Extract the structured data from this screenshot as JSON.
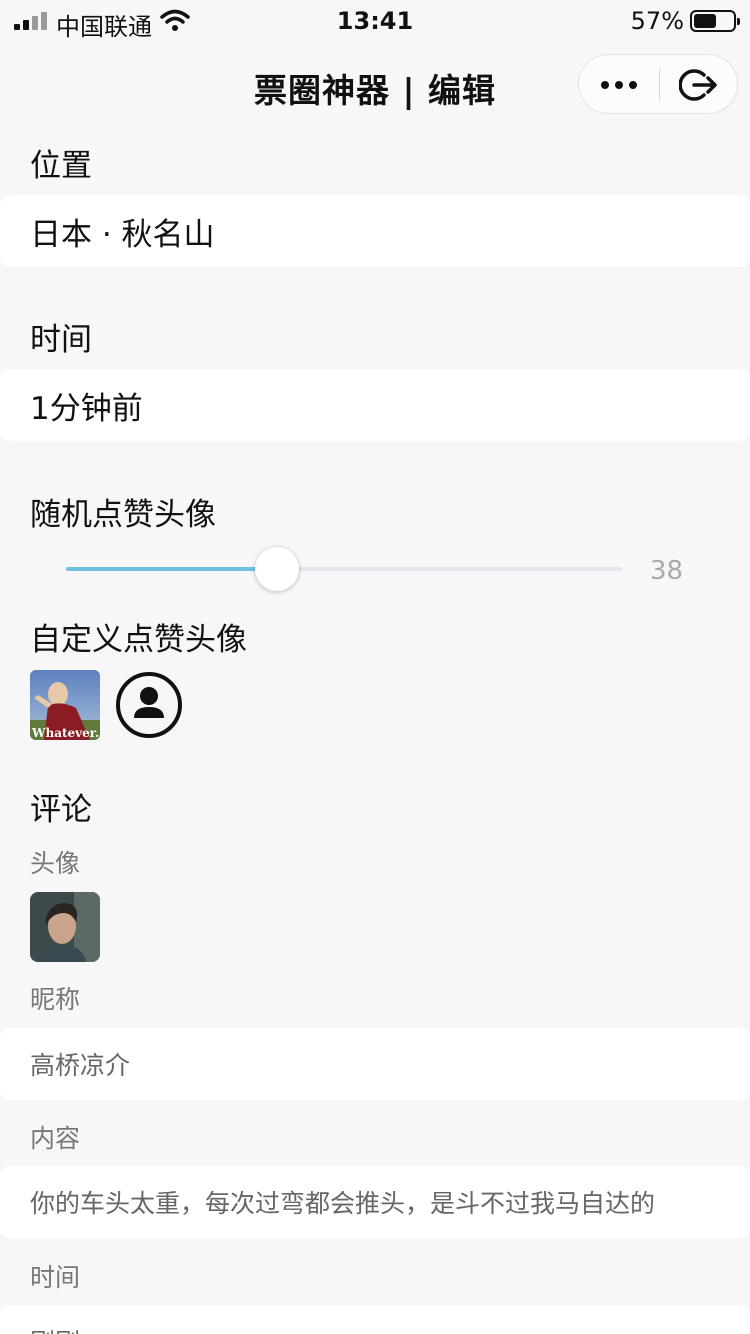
{
  "status_bar": {
    "carrier": "中国联通",
    "time": "13:41",
    "battery_percent": "57%",
    "battery_level": 0.57
  },
  "nav": {
    "title": "票圈神器 | 编辑",
    "more_icon": "ellipsis-icon",
    "exit_icon": "exit-icon"
  },
  "location": {
    "label": "位置",
    "value": "日本 · 秋名山"
  },
  "time_section": {
    "label": "时间",
    "value": "1分钟前"
  },
  "random_likes": {
    "label": "随机点赞头像",
    "value": "38",
    "fraction": 0.38,
    "accent_color": "#6ec0e0"
  },
  "custom_likes": {
    "label": "自定义点赞头像",
    "photo_caption": "Whatever.",
    "add_icon": "person-icon"
  },
  "comment": {
    "label": "评论",
    "avatar_label": "头像",
    "nickname_label": "昵称",
    "nickname_value": "高桥凉介",
    "content_label": "内容",
    "content_value": "你的车头太重，每次过弯都会推头，是斗不过我马自达的",
    "time_label": "时间",
    "time_value": "刚刚"
  }
}
